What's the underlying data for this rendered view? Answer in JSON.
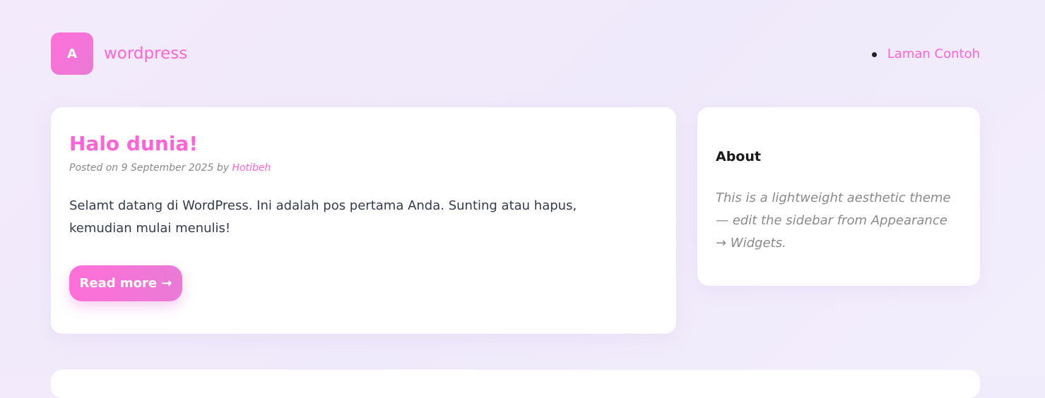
{
  "header": {
    "logo_letter": "A",
    "site_title": "wordpress",
    "nav": [
      {
        "label": "Laman Contoh"
      }
    ]
  },
  "post": {
    "title": "Halo dunia!",
    "meta_prefix": "Posted on 9 September 2025 by ",
    "author": "Hotibeh",
    "excerpt": "Selamt datang di WordPress. Ini adalah pos pertama Anda. Sunting atau hapus, kemudian mulai menulis!",
    "read_more_label": "Read more →"
  },
  "sidebar": {
    "widget_title": "About",
    "widget_text": "This is a lightweight aesthetic theme — edit the sidebar from Appearance → Widgets."
  },
  "colors": {
    "accent": "#ff63d5",
    "accent_gradient_end": "#e97ad6",
    "background": "#f1ebfb",
    "card": "#ffffff",
    "body_text": "#333a48",
    "muted_text": "#8a8a8a"
  }
}
